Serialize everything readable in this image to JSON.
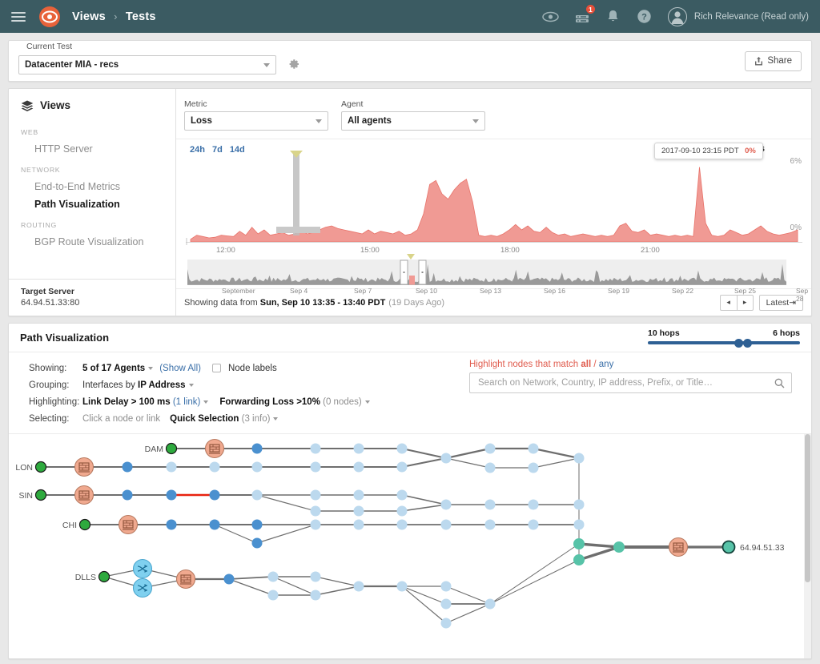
{
  "topnav": {
    "menu_icon": "hamburger-icon",
    "logo_icon": "thousandeyes-eye-logo",
    "breadcrumb": {
      "root": "Views",
      "separator": "›",
      "current": "Tests"
    },
    "icons": [
      {
        "name": "eye-icon",
        "badge": null
      },
      {
        "name": "server-icon",
        "badge": "1"
      },
      {
        "name": "bell-icon",
        "badge": null
      },
      {
        "name": "help-icon",
        "badge": null
      }
    ],
    "user": {
      "avatar_icon": "user-avatar-icon",
      "name": "Rich Relevance (Read only)"
    }
  },
  "test_bar": {
    "label": "Current Test",
    "selected_test": "Datacenter MIA - recs",
    "settings_icon": "gear-icon",
    "share_label": "Share",
    "share_icon": "share-upload-icon"
  },
  "sidebar": {
    "header": "Views",
    "header_icon": "layers-icon",
    "groups": [
      {
        "label": "WEB",
        "items": [
          {
            "label": "HTTP Server",
            "active": false
          }
        ]
      },
      {
        "label": "NETWORK",
        "items": [
          {
            "label": "End-to-End Metrics",
            "active": false
          },
          {
            "label": "Path Visualization",
            "active": true
          }
        ]
      },
      {
        "label": "ROUTING",
        "items": [
          {
            "label": "BGP Route Visualization",
            "active": false
          }
        ]
      }
    ],
    "target": {
      "label": "Target Server",
      "value": "64.94.51.33:80"
    }
  },
  "filters": {
    "metric": {
      "label": "Metric",
      "value": "Loss"
    },
    "agent": {
      "label": "Agent",
      "value": "All agents"
    }
  },
  "chart_data": {
    "type": "area",
    "title": "Average Loss",
    "ranges": [
      "24h",
      "7d",
      "14d"
    ],
    "ylabel": "",
    "ylim": [
      0,
      6
    ],
    "ytick_labels": [
      "6%",
      "0%"
    ],
    "xlabel": "",
    "xtick_labels": [
      "12:00",
      "15:00",
      "18:00",
      "21:00"
    ],
    "series_name": "Average Loss",
    "color": "#f09a94",
    "tooltip": {
      "timestamp": "2017-09-10 23:15 PDT",
      "value": "0%"
    },
    "x": [
      0,
      1,
      2,
      3,
      4,
      5,
      6,
      7,
      8,
      9,
      10,
      11,
      12,
      13,
      14,
      15,
      16,
      17,
      18,
      19,
      20,
      21,
      22,
      23,
      24,
      25,
      26,
      27,
      28,
      29,
      30,
      31,
      32,
      33,
      34,
      35,
      36,
      37,
      38,
      39,
      40,
      41,
      42,
      43,
      44,
      45,
      46,
      47,
      48,
      49,
      50,
      51,
      52,
      53,
      54,
      55,
      56,
      57,
      58,
      59,
      60,
      61,
      62,
      63,
      64,
      65,
      66,
      67,
      68,
      69,
      70,
      71,
      72,
      73,
      74,
      75,
      76,
      77,
      78,
      79,
      80,
      81,
      82,
      83,
      84,
      85,
      86,
      87,
      88,
      89,
      90,
      91,
      92,
      93,
      94,
      95,
      96,
      97,
      98,
      99
    ],
    "values": [
      0.2,
      0.5,
      0.4,
      0.3,
      0.35,
      0.5,
      0.45,
      0.4,
      0.8,
      0.5,
      1.1,
      0.6,
      0.9,
      0.5,
      0.6,
      0.7,
      0.5,
      0.6,
      0.9,
      0.6,
      0.7,
      0.9,
      1.1,
      1.2,
      1.0,
      0.9,
      0.8,
      0.7,
      0.6,
      0.9,
      0.6,
      0.8,
      0.7,
      0.6,
      0.8,
      0.5,
      0.6,
      0.9,
      2.1,
      4.3,
      4.6,
      3.6,
      3.2,
      3.9,
      4.4,
      4.7,
      3.0,
      0.5,
      0.4,
      0.5,
      0.4,
      0.6,
      0.9,
      1.3,
      0.9,
      1.2,
      0.8,
      0.7,
      1.1,
      0.7,
      0.5,
      0.6,
      0.4,
      0.5,
      0.6,
      0.5,
      0.4,
      0.5,
      0.4,
      0.5,
      1.2,
      1.4,
      0.8,
      0.7,
      0.9,
      0.5,
      0.6,
      0.5,
      0.4,
      0.5,
      0.4,
      0.5,
      0.4,
      5.6,
      1.4,
      0.5,
      0.4,
      0.5,
      0.9,
      0.7,
      0.5,
      0.6,
      0.9,
      1.2,
      0.8,
      0.6,
      0.5,
      0.6,
      0.7,
      0.9
    ],
    "minimap": {
      "tick_labels": [
        "September",
        "Sep 4",
        "Sep 7",
        "Sep 10",
        "Sep 13",
        "Sep 16",
        "Sep 19",
        "Sep 22",
        "Sep 25",
        "Sep 28"
      ],
      "selection_marker": "brush-handle"
    }
  },
  "chart_footer": {
    "prefix": "Showing data from",
    "range": "Sun, Sep 10 13:35 - 13:40 PDT",
    "relative": "(19 Days Ago)",
    "prev_icon": "◂",
    "next_icon": "▸",
    "latest_label": "Latest⇥"
  },
  "path_viz": {
    "title": "Path Visualization",
    "hops": {
      "left_label": "10 hops",
      "right_label": "6 hops"
    },
    "controls": {
      "showing": {
        "key": "Showing:",
        "value": "5 of 17 Agents",
        "show_all": "(Show All)",
        "node_labels": "Node labels",
        "node_labels_checked": false
      },
      "grouping": {
        "key": "Grouping:",
        "prefix": "Interfaces by",
        "value": "IP Address"
      },
      "highlighting": {
        "key": "Highlighting:",
        "item1": "Link Delay > 100 ms",
        "item1_count": "(1 link)",
        "item2": "Forwarding Loss >10%",
        "item2_count": "(0 nodes)"
      },
      "selecting": {
        "key": "Selecting:",
        "hint": "Click a node or link",
        "value": "Quick Selection",
        "count": "(3 info)"
      }
    },
    "highlight": {
      "prompt_prefix": "Highlight nodes that match",
      "all": "all",
      "slash": "/",
      "any": "any",
      "search_placeholder": "Search on Network, Country, IP address, Prefix, or Title…",
      "search_value": "",
      "search_icon": "search-icon"
    },
    "agents": [
      "DAM",
      "LON",
      "SIN",
      "CHI",
      "DLLS"
    ],
    "destination_label": "64.94.51.33",
    "node_icons": {
      "firewall": "firewall-icon",
      "mpls": "shuffle-mpls-icon"
    },
    "colors": {
      "agent_node": "#2eaa3e",
      "firewall_node": "#f0a98f",
      "mpls_node": "#7fd0ef",
      "interface_dark": "#4a90cf",
      "interface_light": "#bcd9ee",
      "destination_green": "#57c3a8",
      "highlighted_link": "#e8220f"
    }
  }
}
